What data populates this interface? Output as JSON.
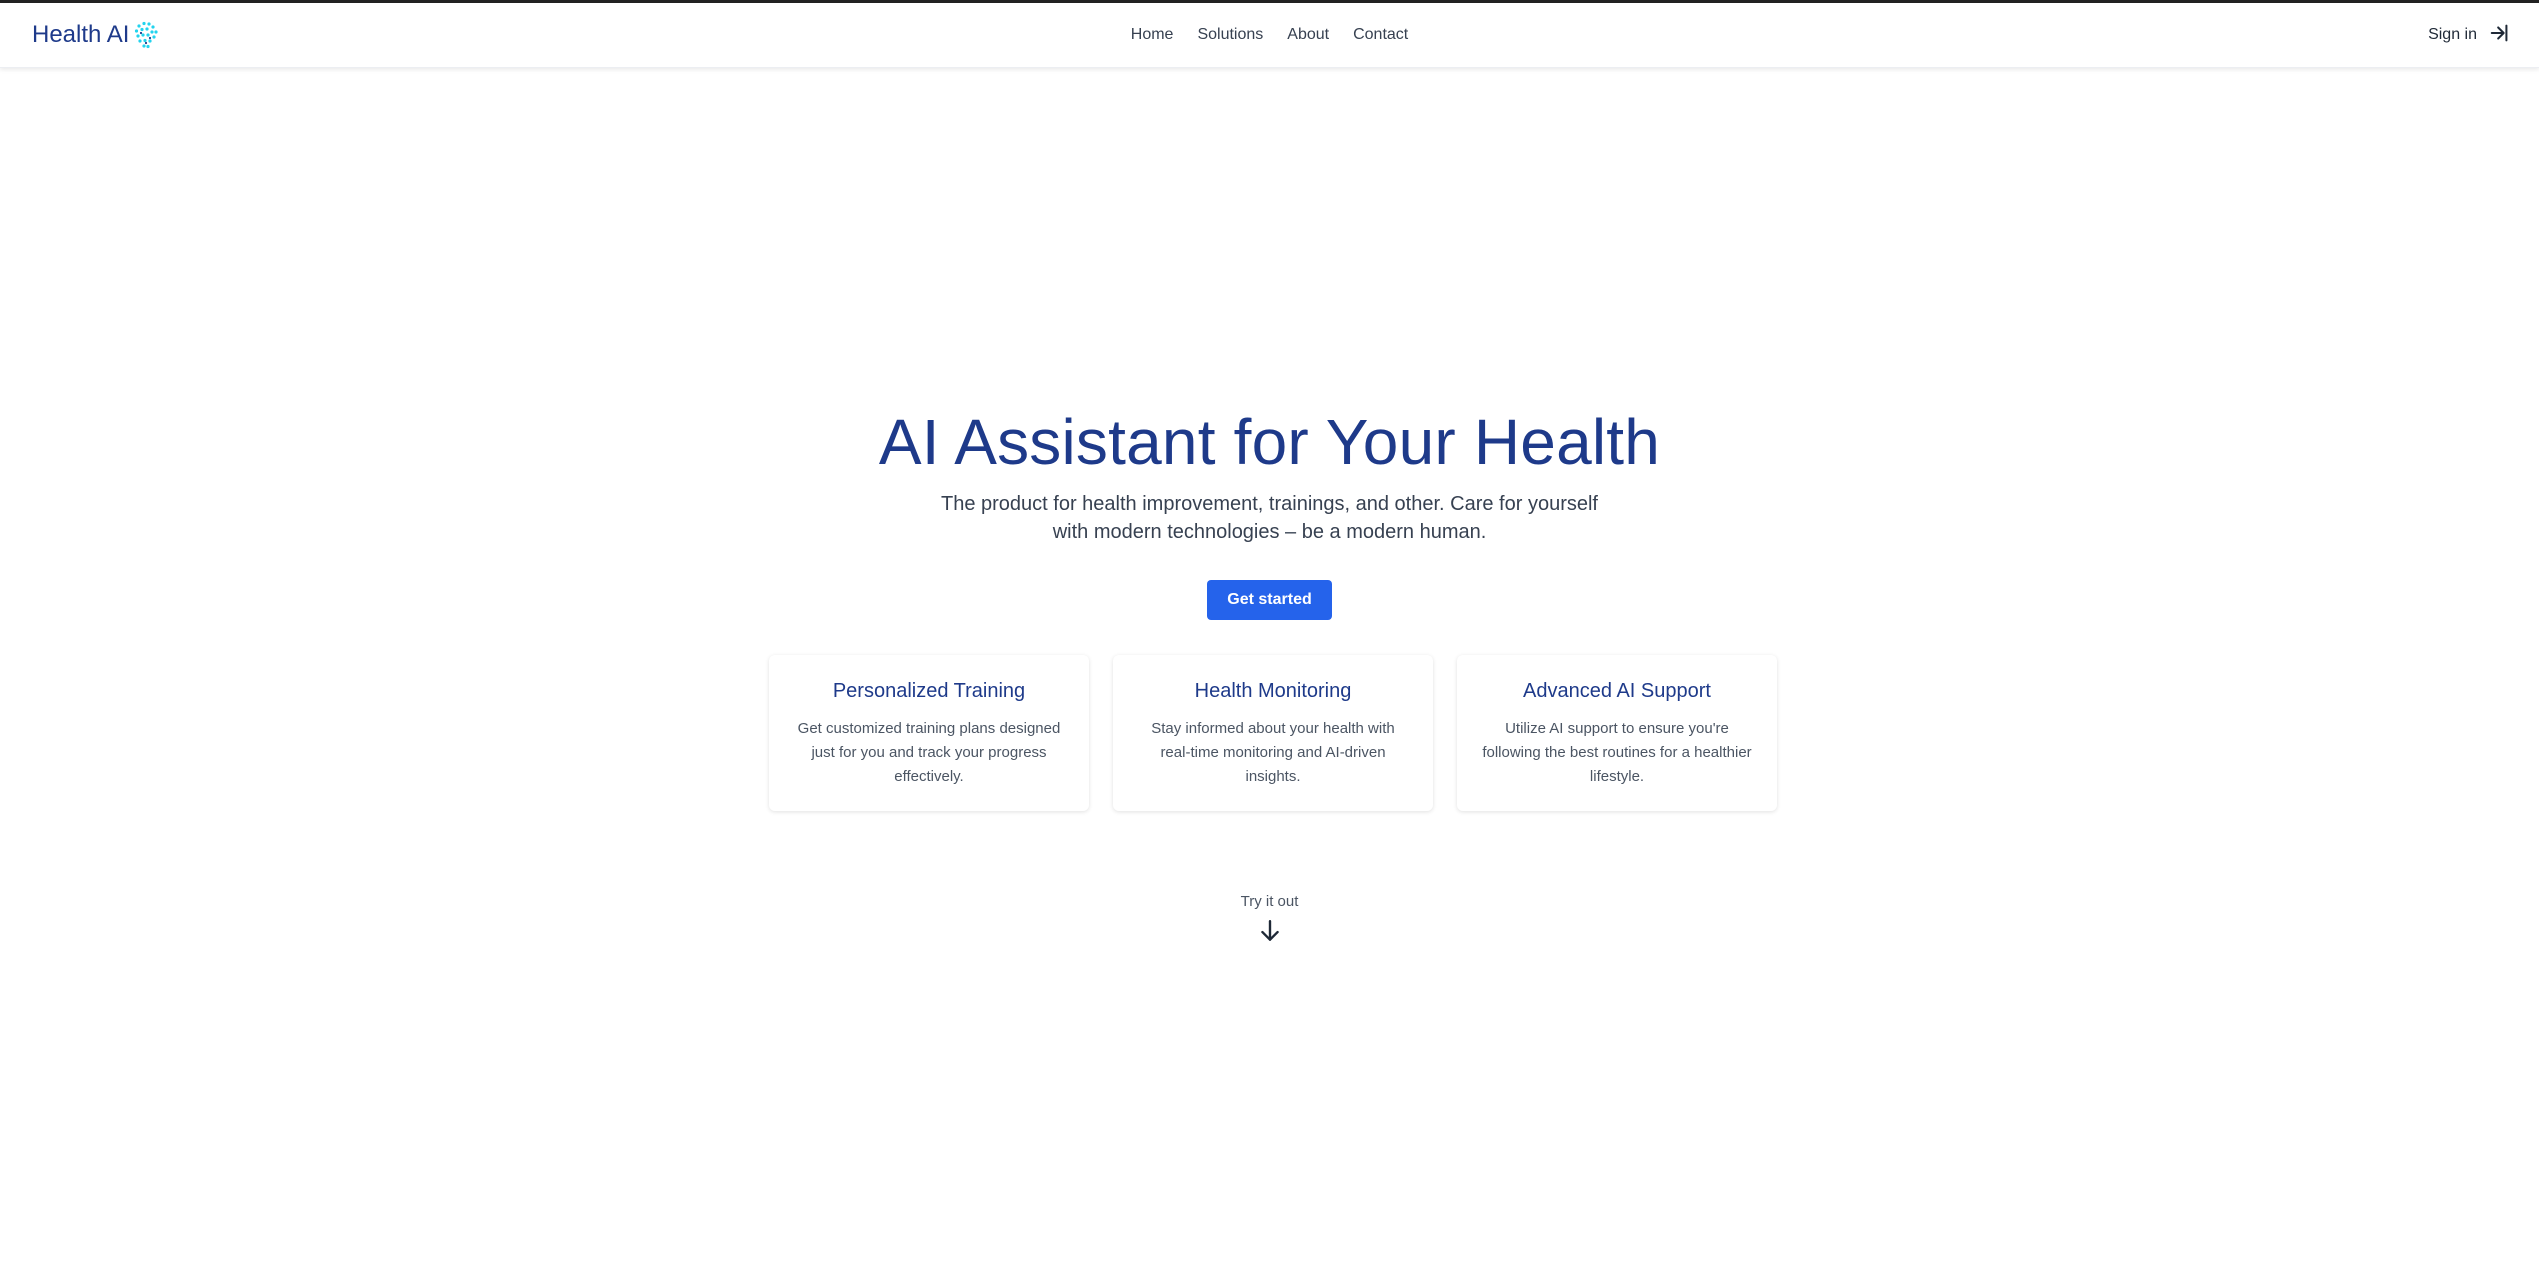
{
  "header": {
    "logo_text": "Health AI",
    "logo_icon": "dotted-brain-icon",
    "nav": [
      {
        "label": "Home"
      },
      {
        "label": "Solutions"
      },
      {
        "label": "About"
      },
      {
        "label": "Contact"
      }
    ],
    "signin_label": "Sign in",
    "signin_icon": "sign-in-arrow-icon"
  },
  "hero": {
    "title": "AI Assistant for Your Health",
    "subtitle": "The product for health improvement, trainings, and other. Care for yourself with modern technologies – be a modern human.",
    "cta_label": "Get started"
  },
  "features": [
    {
      "title": "Personalized Training",
      "text": "Get customized training plans designed just for you and track your progress effectively."
    },
    {
      "title": "Health Monitoring",
      "text": "Stay informed about your health with real-time monitoring and AI-driven insights."
    },
    {
      "title": "Advanced AI Support",
      "text": "Utilize AI support to ensure you're following the best routines for a healthier lifestyle."
    }
  ],
  "try_it": {
    "label": "Try it out",
    "icon": "arrow-down-icon"
  },
  "colors": {
    "brand": "#1e3a8a",
    "accent": "#2563eb",
    "logo_accent": "#22d3ee"
  }
}
